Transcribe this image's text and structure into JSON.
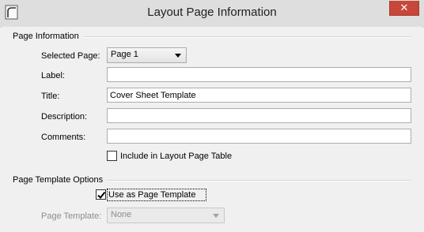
{
  "window": {
    "title": "Layout Page Information",
    "close_symbol": "✕"
  },
  "page_information": {
    "group_label": "Page Information",
    "selected_page_label": "Selected Page:",
    "selected_page_value": "Page 1",
    "label_label": "Label:",
    "label_value": "",
    "title_label": "Title:",
    "title_value": "Cover Sheet Template",
    "description_label": "Description:",
    "description_value": "",
    "comments_label": "Comments:",
    "comments_value": "",
    "include_in_table_label": "Include in Layout Page Table",
    "include_in_table_checked": false
  },
  "page_template_options": {
    "group_label": "Page Template Options",
    "use_as_template_label": "Use as Page Template",
    "use_as_template_checked": true,
    "page_template_label": "Page Template:",
    "page_template_value": "None"
  },
  "icons": [
    "app-icon",
    "close-icon",
    "chevron-down-icon",
    "checkmark-icon"
  ]
}
